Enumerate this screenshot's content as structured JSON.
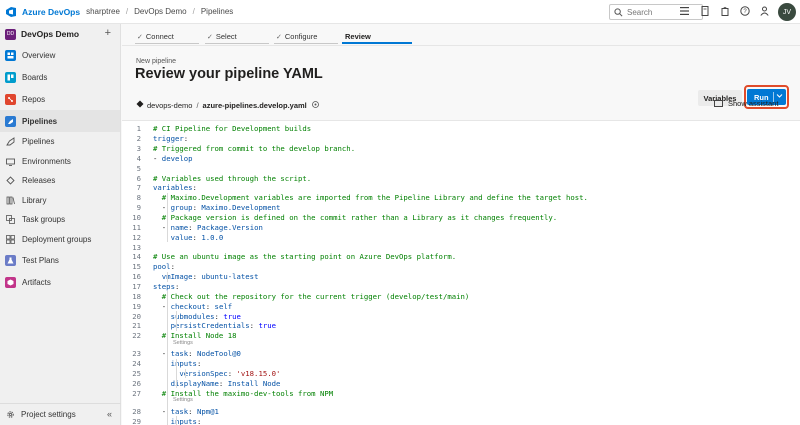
{
  "topbar": {
    "brand": "Azure DevOps",
    "breadcrumbs": [
      "sharptree",
      "DevOps Demo",
      "Pipelines"
    ],
    "search_placeholder": "Search",
    "avatar_initials": "JV"
  },
  "sidebar": {
    "project_badge": "DD",
    "project_name": "DevOps Demo",
    "items": [
      {
        "label": "Overview",
        "icon": "overview-icon",
        "color": "#0078d4"
      },
      {
        "label": "Boards",
        "icon": "boards-icon",
        "color": "#009ccc"
      },
      {
        "label": "Repos",
        "icon": "repos-icon",
        "color": "#e0462f"
      }
    ],
    "pipelines": {
      "label": "Pipelines",
      "icon": "pipelines-icon",
      "color": "#2a7ad2"
    },
    "sub_items": [
      {
        "label": "Pipelines",
        "icon": "pipelines-sub-icon"
      },
      {
        "label": "Environments",
        "icon": "environments-icon"
      },
      {
        "label": "Releases",
        "icon": "releases-icon"
      },
      {
        "label": "Library",
        "icon": "library-icon"
      },
      {
        "label": "Task groups",
        "icon": "task-groups-icon"
      },
      {
        "label": "Deployment groups",
        "icon": "deployment-groups-icon"
      }
    ],
    "items2": [
      {
        "label": "Test Plans",
        "icon": "test-plans-icon",
        "color": "#6b7cc7"
      },
      {
        "label": "Artifacts",
        "icon": "artifacts-icon",
        "color": "#c2358a"
      }
    ],
    "bottom": "Project settings"
  },
  "steps": [
    {
      "label": "Connect",
      "done": true
    },
    {
      "label": "Select",
      "done": true
    },
    {
      "label": "Configure",
      "done": true
    },
    {
      "label": "Review",
      "done": false,
      "current": true
    }
  ],
  "page": {
    "subtitle": "New pipeline",
    "title": "Review your pipeline YAML",
    "variables_label": "Variables",
    "run_label": "Run"
  },
  "pathbar": {
    "repo": "devops-demo",
    "file": "azure-pipelines.develop.yaml",
    "assistant": "Show assistant"
  },
  "editor": {
    "settings_label": "Settings",
    "lines": [
      {
        "n": "1",
        "t": "# CI Pipeline for Development builds"
      },
      {
        "n": "2",
        "t": "trigger:"
      },
      {
        "n": "3",
        "t": "# Triggered from commit to the develop branch."
      },
      {
        "n": "4",
        "t": "- develop"
      },
      {
        "n": "5",
        "t": ""
      },
      {
        "n": "6",
        "t": "# Variables used through the script."
      },
      {
        "n": "7",
        "t": "variables:"
      },
      {
        "n": "8",
        "t": "  # Maximo.Development variables are imported from the Pipeline Library and define the target host."
      },
      {
        "n": "9",
        "t": "  - group: Maximo.Development"
      },
      {
        "n": "10",
        "t": "  # Package version is defined on the commit rather than a Library as it changes frequently."
      },
      {
        "n": "11",
        "t": "  - name: Package.Version"
      },
      {
        "n": "12",
        "t": "    value: 1.0.0"
      },
      {
        "n": "13",
        "t": ""
      },
      {
        "n": "14",
        "t": "# Use an ubuntu image as the starting point on Azure DevOps platform."
      },
      {
        "n": "15",
        "t": "pool:"
      },
      {
        "n": "16",
        "t": "  vmImage: ubuntu-latest"
      },
      {
        "n": "17",
        "t": "steps:"
      },
      {
        "n": "18",
        "t": "  # Check out the repository for the current trigger (develop/test/main)"
      },
      {
        "n": "19",
        "t": "  - checkout: self"
      },
      {
        "n": "20",
        "t": "    submodules: true"
      },
      {
        "n": "21",
        "t": "    persistCredentials: true"
      },
      {
        "n": "22",
        "t": "  # Install Node 18"
      },
      {
        "n": "23",
        "t": "  - task: NodeTool@0"
      },
      {
        "n": "24",
        "t": "    inputs:"
      },
      {
        "n": "25",
        "t": "      versionSpec: 'v18.15.0'"
      },
      {
        "n": "26",
        "t": "    displayName: Install Node"
      },
      {
        "n": "27",
        "t": "  # Install the maximo-dev-tools from NPM"
      },
      {
        "n": "28",
        "t": "  - task: Npm@1"
      },
      {
        "n": "29",
        "t": "    inputs:"
      }
    ]
  }
}
